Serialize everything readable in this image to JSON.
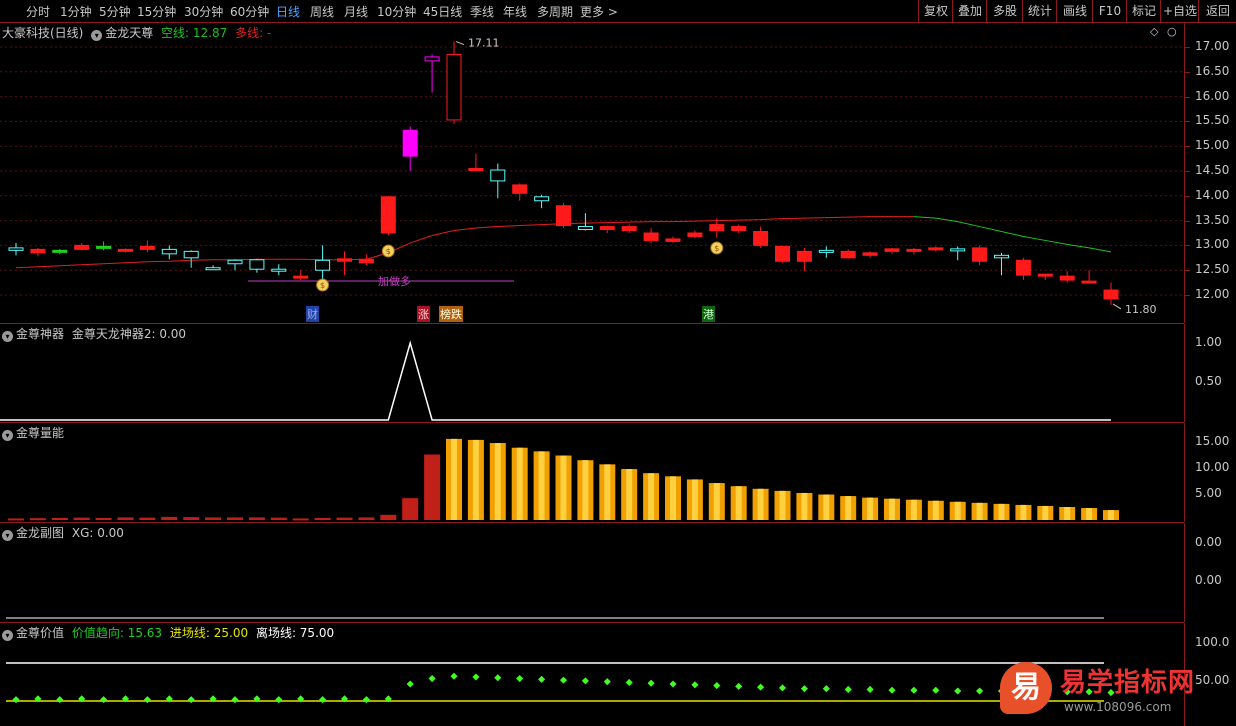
{
  "toolbar": {
    "periods": [
      "分时",
      "1分钟",
      "5分钟",
      "15分钟",
      "30分钟",
      "60分钟",
      "日线",
      "周线",
      "月线",
      "10分钟",
      "45日线",
      "季线",
      "年线",
      "多周期",
      "更多 >"
    ],
    "active_period": "日线",
    "right_buttons": [
      "复权",
      "叠加",
      "多股",
      "统计",
      "画线",
      "F10",
      "标记",
      "+自选",
      "返回"
    ]
  },
  "main_panel": {
    "stock": "大豪科技(日线)",
    "indicator": "金龙天尊",
    "kong_label": "空线: 12.87",
    "duo_label": "多线: -",
    "high_label": "17.11",
    "low_label": "11.80",
    "signal_text": "加做多",
    "event_tags": [
      "财",
      "涨",
      "榜跌",
      "港"
    ],
    "axis_ticks": [
      "17.00",
      "16.50",
      "16.00",
      "15.50",
      "15.00",
      "14.50",
      "14.00",
      "13.50",
      "13.00",
      "12.50",
      "12.00"
    ]
  },
  "panel2": {
    "name": "金尊神器",
    "label": "金尊天龙神器2: 0.00",
    "axis_ticks": [
      "1.00",
      "0.50"
    ]
  },
  "panel3": {
    "name": "金尊量能",
    "axis_ticks": [
      "15.00",
      "10.00",
      "5.00"
    ]
  },
  "panel4": {
    "name": "金龙副图",
    "label": "XG: 0.00",
    "axis_ticks": [
      "0.00",
      "0.00"
    ]
  },
  "panel5": {
    "name": "金尊价值",
    "trend_label": "价值趋向: 15.63",
    "entry_label": "进场线: 25.00",
    "exit_label": "离场线: 75.00",
    "axis_ticks": [
      "100.0",
      "50.00"
    ]
  },
  "watermark": {
    "logo_char": "易",
    "brand": "易学指标网",
    "url": "www.108096.com"
  },
  "colors": {
    "up": "#ff1a1a",
    "down": "#54ffff",
    "ma_red": "#e02020",
    "ma_green": "#20c020",
    "signal": "#c040c0",
    "pink": "#ff00ff"
  },
  "chart_data": {
    "type": "candlestick",
    "candles": [
      {
        "o": 12.95,
        "h": 13.05,
        "l": 12.8,
        "c": 12.9
      },
      {
        "o": 12.85,
        "h": 12.95,
        "l": 12.78,
        "c": 12.92
      },
      {
        "o": 12.87,
        "h": 12.93,
        "l": 12.82,
        "c": 12.9
      },
      {
        "o": 12.92,
        "h": 13.05,
        "l": 12.9,
        "c": 13.0
      },
      {
        "o": 12.98,
        "h": 13.08,
        "l": 12.9,
        "c": 12.98
      },
      {
        "o": 12.9,
        "h": 12.94,
        "l": 12.86,
        "c": 12.92
      },
      {
        "o": 12.92,
        "h": 13.1,
        "l": 12.86,
        "c": 12.98
      },
      {
        "o": 12.92,
        "h": 13.0,
        "l": 12.72,
        "c": 12.83
      },
      {
        "o": 12.88,
        "h": 12.9,
        "l": 12.55,
        "c": 12.75
      },
      {
        "o": 12.55,
        "h": 12.6,
        "l": 12.5,
        "c": 12.52
      },
      {
        "o": 12.7,
        "h": 12.72,
        "l": 12.5,
        "c": 12.63
      },
      {
        "o": 12.71,
        "h": 12.73,
        "l": 12.45,
        "c": 12.52
      },
      {
        "o": 12.52,
        "h": 12.62,
        "l": 12.4,
        "c": 12.48
      },
      {
        "o": 12.38,
        "h": 12.5,
        "l": 12.3,
        "c": 12.38
      },
      {
        "o": 12.7,
        "h": 13.0,
        "l": 12.3,
        "c": 12.5
      },
      {
        "o": 12.68,
        "h": 12.88,
        "l": 12.4,
        "c": 12.73
      },
      {
        "o": 12.65,
        "h": 12.82,
        "l": 12.6,
        "c": 12.72
      },
      {
        "o": 13.25,
        "h": 14.0,
        "l": 13.2,
        "c": 13.98
      },
      {
        "o": 14.8,
        "h": 15.4,
        "l": 14.5,
        "c": 15.32
      },
      {
        "o": 16.8,
        "h": 16.85,
        "l": 16.08,
        "c": 16.72
      },
      {
        "o": 15.53,
        "h": 17.11,
        "l": 15.45,
        "c": 16.85
      },
      {
        "o": 14.55,
        "h": 14.85,
        "l": 14.5,
        "c": 14.55
      },
      {
        "o": 14.52,
        "h": 14.65,
        "l": 13.95,
        "c": 14.3
      },
      {
        "o": 14.05,
        "h": 14.25,
        "l": 13.9,
        "c": 14.22
      },
      {
        "o": 13.98,
        "h": 14.02,
        "l": 13.75,
        "c": 13.9
      },
      {
        "o": 13.4,
        "h": 13.85,
        "l": 13.35,
        "c": 13.8
      },
      {
        "o": 13.38,
        "h": 13.65,
        "l": 13.3,
        "c": 13.32
      },
      {
        "o": 13.32,
        "h": 13.4,
        "l": 13.25,
        "c": 13.38
      },
      {
        "o": 13.3,
        "h": 13.42,
        "l": 13.25,
        "c": 13.38
      },
      {
        "o": 13.1,
        "h": 13.35,
        "l": 13.05,
        "c": 13.25
      },
      {
        "o": 13.08,
        "h": 13.18,
        "l": 13.05,
        "c": 13.13
      },
      {
        "o": 13.18,
        "h": 13.3,
        "l": 13.15,
        "c": 13.25
      },
      {
        "o": 13.3,
        "h": 13.55,
        "l": 13.15,
        "c": 13.42
      },
      {
        "o": 13.3,
        "h": 13.42,
        "l": 13.25,
        "c": 13.38
      },
      {
        "o": 13.0,
        "h": 13.38,
        "l": 12.95,
        "c": 13.28
      },
      {
        "o": 12.68,
        "h": 13.0,
        "l": 12.65,
        "c": 12.98
      },
      {
        "o": 12.68,
        "h": 12.95,
        "l": 12.48,
        "c": 12.88
      },
      {
        "o": 12.9,
        "h": 12.98,
        "l": 12.75,
        "c": 12.88
      },
      {
        "o": 12.75,
        "h": 12.92,
        "l": 12.73,
        "c": 12.88
      },
      {
        "o": 12.8,
        "h": 12.88,
        "l": 12.75,
        "c": 12.85
      },
      {
        "o": 12.88,
        "h": 12.95,
        "l": 12.83,
        "c": 12.93
      },
      {
        "o": 12.88,
        "h": 12.95,
        "l": 12.82,
        "c": 12.92
      },
      {
        "o": 12.92,
        "h": 12.98,
        "l": 12.88,
        "c": 12.95
      },
      {
        "o": 12.93,
        "h": 12.98,
        "l": 12.7,
        "c": 12.92
      },
      {
        "o": 12.68,
        "h": 13.0,
        "l": 12.6,
        "c": 12.95
      },
      {
        "o": 12.8,
        "h": 12.85,
        "l": 12.4,
        "c": 12.75
      },
      {
        "o": 12.4,
        "h": 12.75,
        "l": 12.3,
        "c": 12.7
      },
      {
        "o": 12.4,
        "h": 12.43,
        "l": 12.3,
        "c": 12.42
      },
      {
        "o": 12.3,
        "h": 12.48,
        "l": 12.25,
        "c": 12.38
      },
      {
        "o": 12.28,
        "h": 12.5,
        "l": 12.26,
        "c": 12.28
      },
      {
        "o": 11.92,
        "h": 12.25,
        "l": 11.8,
        "c": 12.1
      }
    ],
    "ma_line": [
      12.55,
      12.57,
      12.59,
      12.61,
      12.63,
      12.65,
      12.67,
      12.68,
      12.7,
      12.71,
      12.71,
      12.72,
      12.72,
      12.72,
      12.71,
      12.71,
      12.72,
      12.85,
      13.05,
      13.2,
      13.3,
      13.35,
      13.38,
      13.4,
      13.42,
      13.44,
      13.45,
      13.46,
      13.47,
      13.48,
      13.48,
      13.49,
      13.5,
      13.51,
      13.52,
      13.54,
      13.55,
      13.56,
      13.57,
      13.58,
      13.58,
      13.58,
      13.55,
      13.48,
      13.38,
      13.28,
      13.18,
      13.1,
      13.02,
      12.95,
      12.87
    ],
    "panel2_values": [
      0,
      0,
      0,
      0,
      0,
      0,
      0,
      0,
      0,
      0,
      0,
      0,
      0,
      0,
      0,
      0,
      0,
      0,
      1,
      0,
      0,
      0,
      0,
      0,
      0,
      0,
      0,
      0,
      0,
      0,
      0,
      0,
      0,
      0,
      0,
      0,
      0,
      0,
      0,
      0,
      0,
      0,
      0,
      0,
      0,
      0,
      0,
      0,
      0,
      0,
      0
    ],
    "volume_bars": [
      0.3,
      0.35,
      0.4,
      0.45,
      0.4,
      0.5,
      0.45,
      0.6,
      0.55,
      0.5,
      0.5,
      0.5,
      0.45,
      0.3,
      0.4,
      0.45,
      0.5,
      1.0,
      4.2,
      12.6,
      15.6,
      15.4,
      14.8,
      13.9,
      13.2,
      12.4,
      11.5,
      10.7,
      9.8,
      9.0,
      8.4,
      7.8,
      7.1,
      6.5,
      6.0,
      5.6,
      5.2,
      4.9,
      4.6,
      4.3,
      4.1,
      3.9,
      3.7,
      3.5,
      3.3,
      3.1,
      2.9,
      2.7,
      2.5,
      2.3,
      1.9
    ],
    "trend_dots": [
      30,
      31,
      30,
      31,
      30,
      31,
      30,
      31,
      30,
      31,
      30,
      31,
      30,
      31,
      30,
      31,
      30,
      31,
      50,
      57,
      60,
      59,
      58,
      57,
      56,
      55,
      54,
      53,
      52,
      51,
      50,
      49,
      48,
      47,
      46,
      45,
      44,
      44,
      43,
      43,
      42,
      42,
      42,
      41,
      41,
      41,
      40,
      40,
      40,
      40,
      39
    ]
  }
}
